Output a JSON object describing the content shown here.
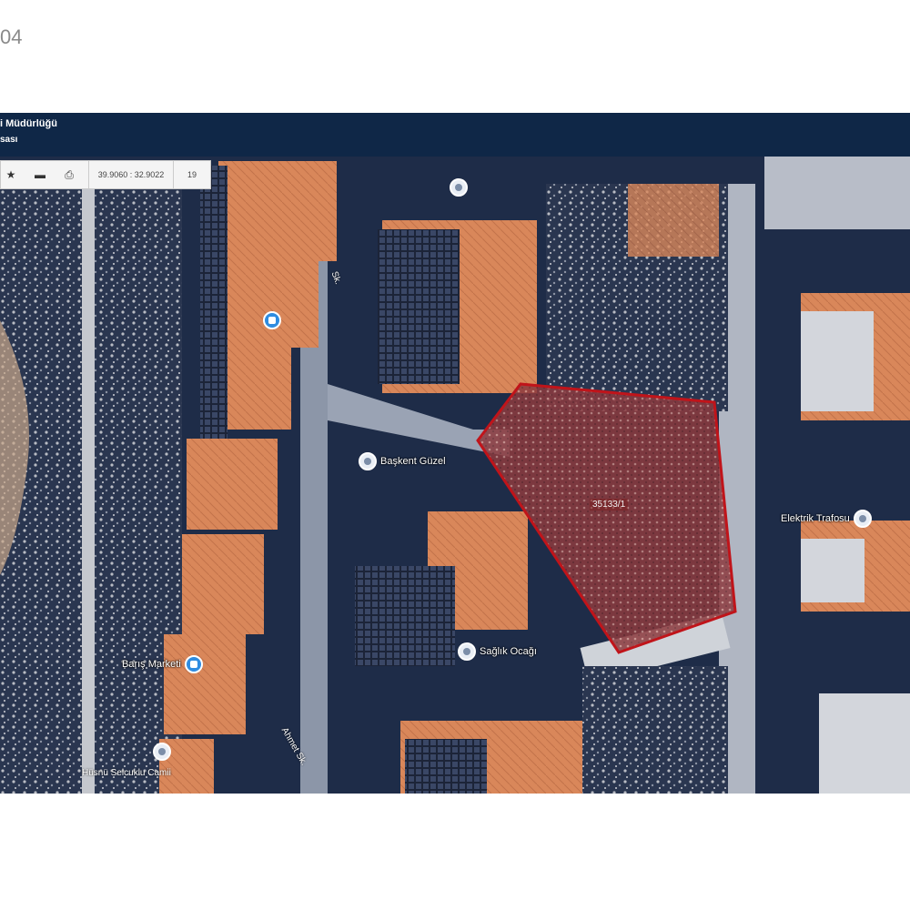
{
  "corner_text": "04",
  "header": {
    "title": "i Müdürlüğü",
    "subtitle": "sası"
  },
  "toolbar": {
    "coords": "39.9060 : 32.9022",
    "zoom": "19"
  },
  "parcel": {
    "label": "35133/1",
    "color": "#c0141a"
  },
  "pois": [
    {
      "name": "",
      "icon": "place-icon"
    },
    {
      "name": "",
      "icon": "shop-icon"
    },
    {
      "name": "Başkent Güzel",
      "icon": "place-icon"
    },
    {
      "name": "Elektrik Trafosu",
      "icon": "place-icon"
    },
    {
      "name": "Barış Marketi",
      "icon": "shop-icon"
    },
    {
      "name": "Hüsnü Selcuklu Camii",
      "icon": "place-icon"
    },
    {
      "name": "Sağlık Ocağı",
      "icon": "place-icon"
    }
  ],
  "roads": [
    "Sk.",
    "Ahmet Sk."
  ]
}
